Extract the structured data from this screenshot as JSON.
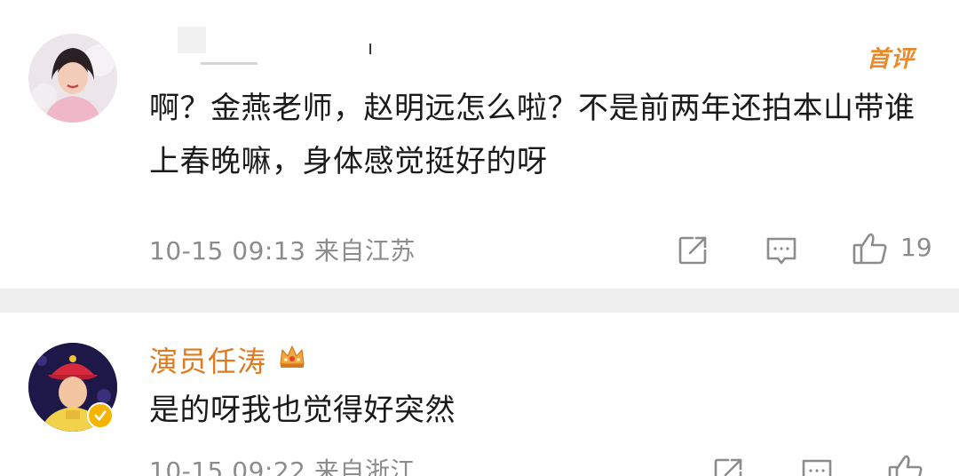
{
  "comments": [
    {
      "username_hidden_mark": "ı",
      "first_badge": "首评",
      "text": "啊？金燕老师，赵明远怎么啦？不是前两年还拍本山带谁上春晚嘛，身体感觉挺好的呀",
      "meta": "10-15 09:13  来自江苏",
      "like_count": "19"
    },
    {
      "username": "演员任涛",
      "text": "是的呀我也觉得好突然",
      "meta": "10-15 09:22  来自浙江"
    }
  ],
  "icons": {
    "share": "share-icon",
    "reply": "comment-icon",
    "like": "thumbs-up-icon",
    "crown": "crown-icon",
    "verified": "verified-badge-icon"
  },
  "colors": {
    "accent_orange": "#e07a1f",
    "meta_gray": "#8c8c8c",
    "divider": "#efefef"
  }
}
